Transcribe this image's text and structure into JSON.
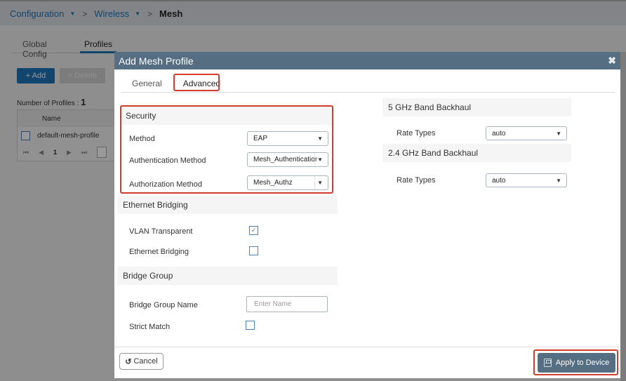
{
  "breadcrumb": {
    "items": [
      "Configuration",
      "Wireless"
    ],
    "separator": ">",
    "current": "Mesh"
  },
  "background_page": {
    "tabs": [
      "Global Config",
      "Profiles"
    ],
    "active_tab": "Profiles",
    "add_label": "+ Add",
    "delete_label": "× Delete",
    "profile_count_label": "Number of Profiles :",
    "profile_count": "1",
    "table": {
      "columns": [
        "Name"
      ],
      "rows": [
        {
          "name": "default-mesh-profile"
        }
      ]
    },
    "pager": {
      "first": "⏮",
      "prev": "◀",
      "page": "1",
      "next": "▶",
      "last": "⏭"
    }
  },
  "modal": {
    "title": "Add Mesh Profile",
    "close_icon": "✖",
    "tabs": [
      "General",
      "Advanced"
    ],
    "active_tab": "Advanced",
    "security": {
      "heading": "Security",
      "method_label": "Method",
      "method_value": "EAP",
      "auth_method_label": "Authentication Method",
      "auth_method_value": "Mesh_Authentication",
      "authz_method_label": "Authorization Method",
      "authz_method_value": "Mesh_Authz"
    },
    "ethernet_bridging": {
      "heading": "Ethernet Bridging",
      "vlan_transparent_label": "VLAN Transparent",
      "vlan_transparent_checked": true,
      "ethernet_bridging_label": "Ethernet Bridging",
      "ethernet_bridging_checked": false
    },
    "bridge_group": {
      "heading": "Bridge Group",
      "name_label": "Bridge Group Name",
      "name_value": "",
      "name_placeholder": "Enter Name",
      "strict_match_label": "Strict Match",
      "strict_match_checked": false
    },
    "band_5ghz": {
      "heading": "5 GHz Band Backhaul",
      "rate_types_label": "Rate Types",
      "rate_types_value": "auto"
    },
    "band_24ghz": {
      "heading": "2.4 GHz Band Backhaul",
      "rate_types_label": "Rate Types",
      "rate_types_value": "auto"
    },
    "footer": {
      "cancel_label": "Cancel",
      "cancel_icon": "↺",
      "apply_label": "Apply to Device"
    }
  },
  "colors": {
    "header": "#566e82",
    "highlight": "#d33b2a",
    "link": "#1f74b7"
  }
}
